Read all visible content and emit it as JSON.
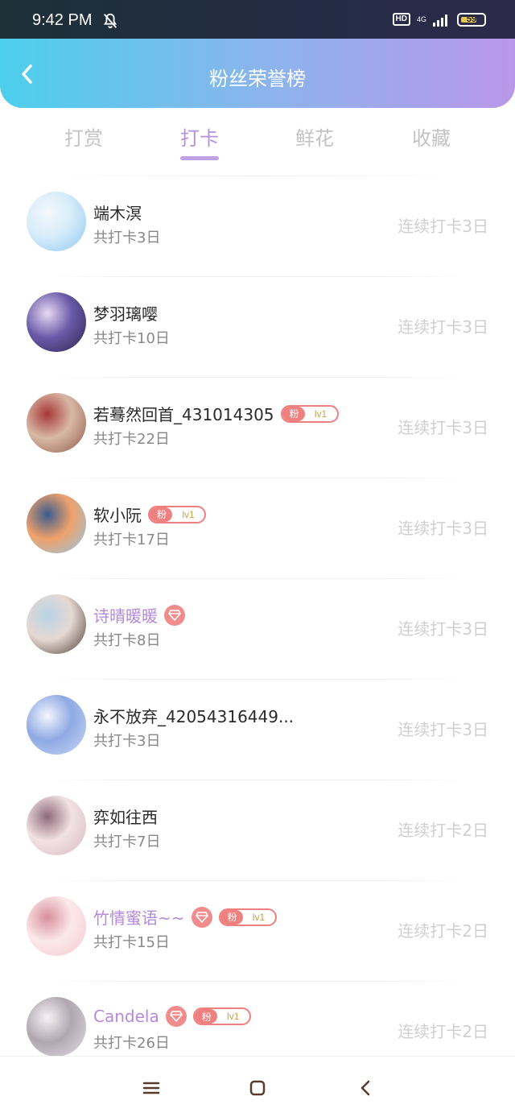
{
  "status_bar": {
    "time": "9:42 PM",
    "hd": "HD",
    "network": "4G",
    "battery": "59",
    "icons": [
      "bell-off-icon",
      "signal-icon",
      "battery-icon"
    ]
  },
  "header": {
    "title": "粉丝荣誉榜",
    "back_icon": "chevron-left-icon"
  },
  "tabs": [
    {
      "label": "打赏",
      "active": false
    },
    {
      "label": "打卡",
      "active": true
    },
    {
      "label": "鲜花",
      "active": false
    },
    {
      "label": "收藏",
      "active": false
    }
  ],
  "colors": {
    "accent": "#b591de",
    "header_start": "#4ccfec",
    "header_end": "#b997e8",
    "badge_red": "#f08080",
    "muted": "#cfcfcf"
  },
  "list": [
    {
      "name": "端木溟",
      "subtitle": "共打卡3日",
      "streak": "连续打卡3日",
      "vip": false,
      "diamond": false,
      "fan_badge": null,
      "avatar_colors": [
        "#8fc9f0",
        "#d6ecfa",
        "#f4f7fb"
      ]
    },
    {
      "name": "梦羽璃嘤",
      "subtitle": "共打卡10日",
      "streak": "连续打卡3日",
      "vip": false,
      "diamond": false,
      "fan_badge": null,
      "avatar_colors": [
        "#2b2550",
        "#6a5aa8",
        "#e9d9f4"
      ]
    },
    {
      "name": "若蓦然回首_431014305",
      "subtitle": "共打卡22日",
      "streak": "连续打卡3日",
      "vip": false,
      "diamond": false,
      "fan_badge": {
        "label": "粉",
        "level": "lv1"
      },
      "avatar_colors": [
        "#8e5a48",
        "#d8b9a5",
        "#a83838"
      ]
    },
    {
      "name": "软小阮",
      "subtitle": "共打卡17日",
      "streak": "连续打卡3日",
      "vip": false,
      "diamond": false,
      "fan_badge": {
        "label": "粉",
        "level": "lv1"
      },
      "avatar_colors": [
        "#8ec7e8",
        "#f0a16a",
        "#3b5d8e"
      ]
    },
    {
      "name": "诗晴暖暖",
      "subtitle": "共打卡8日",
      "streak": "连续打卡3日",
      "vip": true,
      "diamond": true,
      "fan_badge": null,
      "avatar_colors": [
        "#4a3a34",
        "#e6d8d2",
        "#b8d3e6"
      ]
    },
    {
      "name": "永不放弃_42054316449...",
      "subtitle": "共打卡3日",
      "streak": "连续打卡3日",
      "vip": false,
      "diamond": false,
      "fan_badge": null,
      "avatar_colors": [
        "#c8d8f4",
        "#8ea9e4",
        "#f4f6fc"
      ]
    },
    {
      "name": "弈如往西",
      "subtitle": "共打卡7日",
      "streak": "连续打卡2日",
      "vip": false,
      "diamond": false,
      "fan_badge": null,
      "avatar_colors": [
        "#d7b8c2",
        "#f2e2e4",
        "#8e6a7a"
      ]
    },
    {
      "name": "竹情蜜语~~",
      "subtitle": "共打卡15日",
      "streak": "连续打卡2日",
      "vip": true,
      "diamond": true,
      "fan_badge": {
        "label": "粉",
        "level": "lv1"
      },
      "avatar_colors": [
        "#f4c9cf",
        "#fbe8ea",
        "#d8909c"
      ]
    },
    {
      "name": "Candela",
      "subtitle": "共打卡26日",
      "streak": "连续打卡2日",
      "vip": true,
      "diamond": true,
      "fan_badge": {
        "label": "粉",
        "level": "lv1"
      },
      "avatar_colors": [
        "#e6e0e6",
        "#b0a6b0",
        "#f6f2f4"
      ]
    }
  ],
  "navbar": {
    "icons": [
      "menu-icon",
      "home-square-icon",
      "back-arrow-icon"
    ]
  }
}
